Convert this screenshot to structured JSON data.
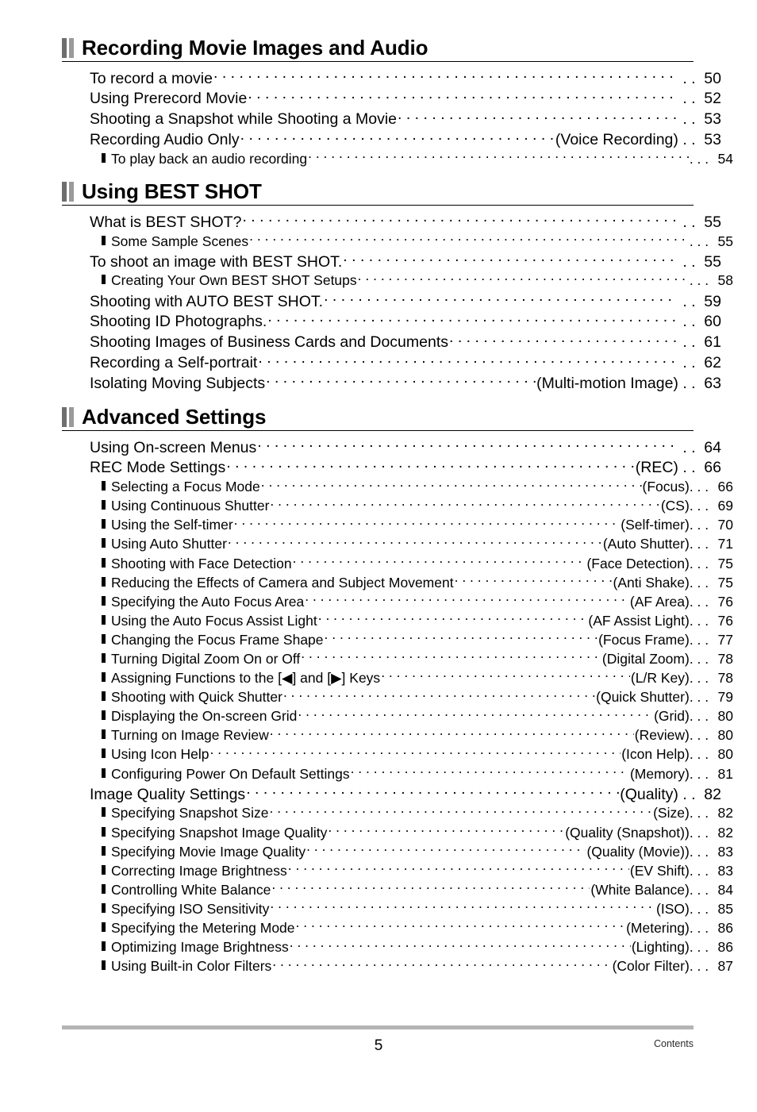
{
  "document": {
    "footer_page_number": "5",
    "footer_label": "Contents"
  },
  "sections": [
    {
      "title": "Recording Movie Images and Audio",
      "page": "50",
      "entries": [
        {
          "level": 1,
          "label": "To record a movie",
          "qualifier": "",
          "page": "50"
        },
        {
          "level": 1,
          "label": "Using Prerecord Movie",
          "qualifier": "",
          "page": "52"
        },
        {
          "level": 1,
          "label": "Shooting a Snapshot while Shooting a Movie",
          "qualifier": "",
          "page": "53"
        },
        {
          "level": 1,
          "label": "Recording Audio Only",
          "qualifier": "(Voice Recording)",
          "page": "53"
        },
        {
          "level": 2,
          "label": "To play back an audio recording",
          "qualifier": "",
          "page": "54"
        }
      ]
    },
    {
      "title": "Using BEST SHOT",
      "page": "55",
      "entries": [
        {
          "level": 1,
          "label": "What is BEST SHOT?",
          "qualifier": "",
          "page": "55"
        },
        {
          "level": 2,
          "label": "Some Sample Scenes",
          "qualifier": "",
          "page": "55"
        },
        {
          "level": 1,
          "label": "To shoot an image with BEST SHOT.",
          "qualifier": "",
          "page": "55"
        },
        {
          "level": 2,
          "label": "Creating Your Own BEST SHOT Setups",
          "qualifier": "",
          "page": "58"
        },
        {
          "level": 1,
          "label": "Shooting with AUTO BEST SHOT.",
          "qualifier": "",
          "page": "59"
        },
        {
          "level": 1,
          "label": "Shooting ID Photographs.",
          "qualifier": "",
          "page": "60"
        },
        {
          "level": 1,
          "label": "Shooting Images of Business Cards and Documents",
          "qualifier": "",
          "page": "61"
        },
        {
          "level": 1,
          "label": "Recording a Self-portrait",
          "qualifier": "",
          "page": "62"
        },
        {
          "level": 1,
          "label": "Isolating Moving Subjects",
          "qualifier": "(Multi-motion Image)",
          "page": "63"
        }
      ]
    },
    {
      "title": "Advanced Settings",
      "page": "64",
      "entries": [
        {
          "level": 1,
          "label": "Using On-screen Menus",
          "qualifier": "",
          "page": "64"
        },
        {
          "level": 1,
          "label": "REC Mode Settings",
          "qualifier": "(REC)",
          "page": "66"
        },
        {
          "level": 2,
          "label": "Selecting a Focus Mode",
          "qualifier": "(Focus)",
          "page": "66"
        },
        {
          "level": 2,
          "label": "Using Continuous Shutter",
          "qualifier": "(CS)",
          "page": "69"
        },
        {
          "level": 2,
          "label": "Using the Self-timer",
          "qualifier": "(Self-timer)",
          "page": "70"
        },
        {
          "level": 2,
          "label": "Using Auto Shutter",
          "qualifier": "(Auto Shutter)",
          "page": "71"
        },
        {
          "level": 2,
          "label": "Shooting with Face Detection",
          "qualifier": "(Face Detection)",
          "page": "75"
        },
        {
          "level": 2,
          "label": "Reducing the Effects of Camera and Subject Movement",
          "qualifier": "(Anti Shake)",
          "page": "75"
        },
        {
          "level": 2,
          "label": "Specifying the Auto Focus Area",
          "qualifier": "(AF Area)",
          "page": "76"
        },
        {
          "level": 2,
          "label": "Using the Auto Focus Assist Light",
          "qualifier": "(AF Assist Light)",
          "page": "76"
        },
        {
          "level": 2,
          "label": "Changing the Focus Frame Shape",
          "qualifier": "(Focus Frame)",
          "page": "77"
        },
        {
          "level": 2,
          "label": "Turning Digital Zoom On or Off",
          "qualifier": "(Digital Zoom)",
          "page": "78"
        },
        {
          "level": 2,
          "label": "Assigning Functions to the [◀] and [▶] Keys",
          "qualifier": "(L/R Key)",
          "page": "78"
        },
        {
          "level": 2,
          "label": "Shooting with Quick Shutter",
          "qualifier": "(Quick Shutter)",
          "page": "79"
        },
        {
          "level": 2,
          "label": "Displaying the On-screen Grid",
          "qualifier": "(Grid)",
          "page": "80"
        },
        {
          "level": 2,
          "label": "Turning on Image Review",
          "qualifier": "(Review)",
          "page": "80"
        },
        {
          "level": 2,
          "label": "Using Icon Help",
          "qualifier": "(Icon Help)",
          "page": "80"
        },
        {
          "level": 2,
          "label": "Configuring Power On Default Settings",
          "qualifier": "(Memory)",
          "page": "81"
        },
        {
          "level": 1,
          "label": "Image Quality Settings",
          "qualifier": "(Quality)",
          "page": "82"
        },
        {
          "level": 2,
          "label": "Specifying Snapshot Size",
          "qualifier": "(Size)",
          "page": "82"
        },
        {
          "level": 2,
          "label": "Specifying Snapshot Image Quality",
          "qualifier": "(Quality (Snapshot))",
          "page": "82"
        },
        {
          "level": 2,
          "label": "Specifying Movie Image Quality",
          "qualifier": "(Quality (Movie))",
          "page": "83"
        },
        {
          "level": 2,
          "label": "Correcting Image Brightness",
          "qualifier": "(EV Shift)",
          "page": "83"
        },
        {
          "level": 2,
          "label": "Controlling White Balance",
          "qualifier": "(White Balance)",
          "page": "84"
        },
        {
          "level": 2,
          "label": "Specifying ISO Sensitivity",
          "qualifier": "(ISO)",
          "page": "85"
        },
        {
          "level": 2,
          "label": "Specifying the Metering Mode",
          "qualifier": "(Metering)",
          "page": "86"
        },
        {
          "level": 2,
          "label": "Optimizing Image Brightness",
          "qualifier": "(Lighting)",
          "page": "86"
        },
        {
          "level": 2,
          "label": "Using Built-in Color Filters",
          "qualifier": "(Color Filter)",
          "page": "87"
        }
      ]
    }
  ]
}
